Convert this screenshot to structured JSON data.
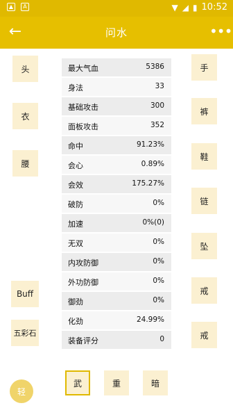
{
  "status_bar": {
    "time": "10:52"
  },
  "app_bar": {
    "title": "问水"
  },
  "left_slots": [
    "头",
    "衣",
    "腰",
    "Buff",
    "五彩石"
  ],
  "right_slots": [
    "手",
    "裤",
    "鞋",
    "链",
    "坠",
    "戒",
    "戒"
  ],
  "stats": [
    {
      "label": "最大气血",
      "value": "5386"
    },
    {
      "label": "身法",
      "value": "33"
    },
    {
      "label": "基础攻击",
      "value": "300"
    },
    {
      "label": "面板攻击",
      "value": "352"
    },
    {
      "label": "命中",
      "value": "91.23%"
    },
    {
      "label": "会心",
      "value": "0.89%"
    },
    {
      "label": "会效",
      "value": "175.27%"
    },
    {
      "label": "破防",
      "value": "0%"
    },
    {
      "label": "加速",
      "value": "0%(0)"
    },
    {
      "label": "无双",
      "value": "0%"
    },
    {
      "label": "内攻防御",
      "value": "0%"
    },
    {
      "label": "外功防御",
      "value": "0%"
    },
    {
      "label": "御劲",
      "value": "0%"
    },
    {
      "label": "化劲",
      "value": "24.99%"
    },
    {
      "label": "装备评分",
      "value": "0"
    }
  ],
  "bottom_buttons": [
    "武",
    "重",
    "暗"
  ],
  "fab": "轻",
  "colors": {
    "accent": "#e6bf00",
    "slot_bg": "#fbf0d1"
  }
}
